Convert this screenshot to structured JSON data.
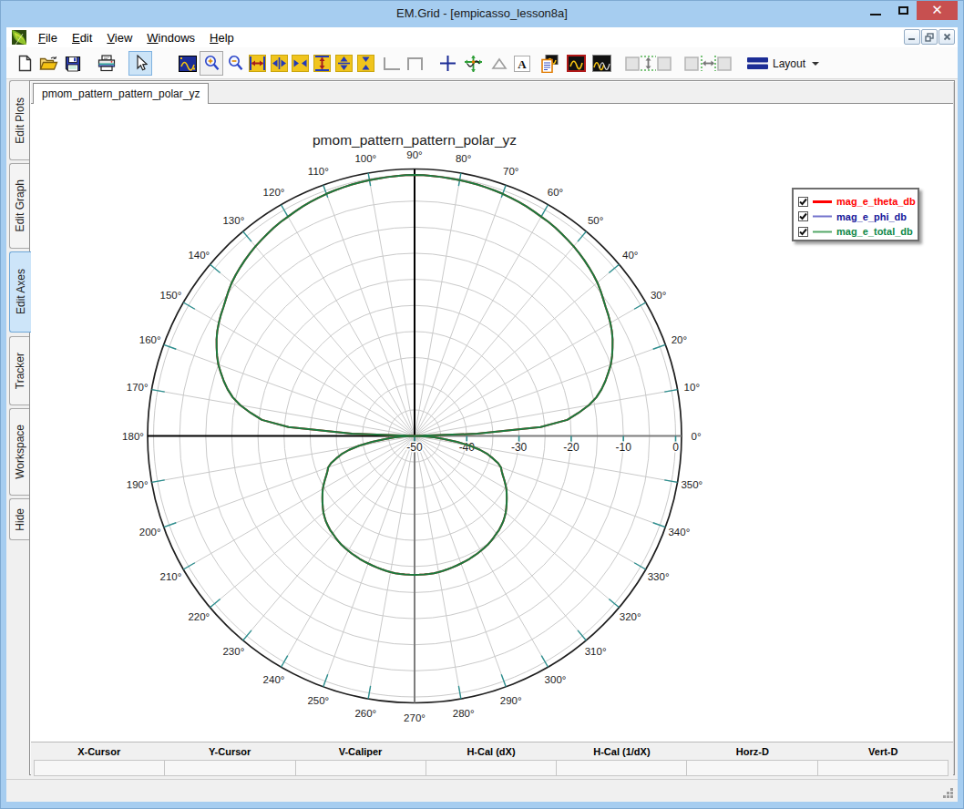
{
  "window": {
    "title": "EM.Grid - [empicasso_lesson8a]",
    "controls": [
      "minimize",
      "maximize",
      "close"
    ]
  },
  "menu": {
    "items": [
      {
        "label": "File",
        "underline_index": 0
      },
      {
        "label": "Edit",
        "underline_index": 0
      },
      {
        "label": "View",
        "underline_index": 0
      },
      {
        "label": "Windows",
        "underline_index": 0
      },
      {
        "label": "Help",
        "underline_index": 0
      }
    ],
    "mdi_controls": [
      "minimize",
      "restore",
      "close"
    ]
  },
  "toolbar": {
    "buttons": [
      {
        "name": "new-document",
        "state": "normal"
      },
      {
        "name": "open-folder",
        "state": "normal"
      },
      {
        "name": "save-floppy",
        "state": "normal"
      },
      {
        "name": "print",
        "state": "normal"
      },
      {
        "name": "select-cursor",
        "state": "active"
      },
      {
        "name": "fit-plot",
        "state": "normal"
      },
      {
        "name": "zoom-in",
        "state": "framed"
      },
      {
        "name": "zoom-out",
        "state": "normal"
      },
      {
        "name": "expand-x-full",
        "state": "normal"
      },
      {
        "name": "expand-x",
        "state": "normal"
      },
      {
        "name": "compress-x",
        "state": "normal"
      },
      {
        "name": "expand-y-full",
        "state": "normal"
      },
      {
        "name": "expand-y",
        "state": "normal"
      },
      {
        "name": "compress-y",
        "state": "normal"
      },
      {
        "name": "corner-bottom-left",
        "state": "disabled"
      },
      {
        "name": "corner-top",
        "state": "disabled"
      },
      {
        "name": "crosshair-plus",
        "state": "normal"
      },
      {
        "name": "tracker-axes",
        "state": "normal"
      },
      {
        "name": "triangle-marker",
        "state": "disabled"
      },
      {
        "name": "text-annotation",
        "state": "normal"
      },
      {
        "name": "copy-plot-report",
        "state": "normal"
      },
      {
        "name": "plot-window-active",
        "state": "normal"
      },
      {
        "name": "plot-window-all",
        "state": "normal"
      },
      {
        "name": "tile-box-left",
        "state": "disabled"
      },
      {
        "name": "space-vertical",
        "state": "disabled"
      },
      {
        "name": "tile-box-right",
        "state": "disabled"
      },
      {
        "name": "tile-box-left2",
        "state": "disabled"
      },
      {
        "name": "space-horizontal",
        "state": "disabled"
      },
      {
        "name": "tile-box-right2",
        "state": "disabled"
      }
    ],
    "layout_label": "Layout"
  },
  "sidebar": {
    "tabs": [
      {
        "label": "Edit Plots",
        "selected": false
      },
      {
        "label": "Edit Graph",
        "selected": false
      },
      {
        "label": "Edit Axes",
        "selected": true
      },
      {
        "label": "Tracker",
        "selected": false
      },
      {
        "label": "Workspace",
        "selected": false
      },
      {
        "label": "Hide",
        "selected": false
      }
    ]
  },
  "document_tabs": [
    {
      "label": "pmom_pattern_pattern_polar_yz",
      "active": true
    }
  ],
  "chart_data": {
    "type": "polar-line",
    "title": "pmom_pattern_pattern_polar_yz",
    "angle_unit": "deg",
    "angle_labels": [
      "0°",
      "10°",
      "20°",
      "30°",
      "40°",
      "50°",
      "60°",
      "70°",
      "80°",
      "90°",
      "100°",
      "110°",
      "120°",
      "130°",
      "140°",
      "150°",
      "160°",
      "170°",
      "180°",
      "190°",
      "200°",
      "210°",
      "220°",
      "230°",
      "240°",
      "250°",
      "260°",
      "270°",
      "280°",
      "290°",
      "300°",
      "310°",
      "320°",
      "330°",
      "340°",
      "350°"
    ],
    "angle_grid_step_deg": 10,
    "radial_axis": {
      "min": -50,
      "max": 0,
      "label_step": 10,
      "grid_step": 5,
      "tick_labels": [
        "-50",
        "-40",
        "-30",
        "-20",
        "-10",
        "0"
      ]
    },
    "grid": true,
    "legend": {
      "position": "top-right",
      "entries": [
        {
          "label": "mag_e_theta_db",
          "checked": true,
          "text_color": "#ff0000",
          "line_color": "#ff0000",
          "line_width": 3
        },
        {
          "label": "mag_e_phi_db",
          "checked": true,
          "text_color": "#16169a",
          "line_color": "#7373cc",
          "line_width": 2
        },
        {
          "label": "mag_e_total_db",
          "checked": true,
          "text_color": "#0d8747",
          "line_color": "#54a868",
          "line_width": 2
        }
      ]
    },
    "series": [
      {
        "name": "mag_e_theta_db",
        "color": "#d22a2a",
        "note": "coincides with mag_e_total_db curve (hidden beneath it)",
        "coincident_with": "mag_e_total_db"
      },
      {
        "name": "mag_e_phi_db",
        "color": "#7373cc",
        "note": "below -50 dB over the whole cut; collapses to plot centre, not visible",
        "values_db": null
      },
      {
        "name": "mag_e_total_db",
        "color": "#1b7a3e",
        "angles_deg": [
          0,
          2,
          4,
          6,
          8,
          10,
          12,
          14,
          16,
          18,
          20,
          22,
          24,
          26,
          28,
          30,
          32,
          34,
          36,
          38,
          40,
          42,
          44,
          46,
          48,
          50,
          52,
          54,
          56,
          58,
          60,
          62,
          64,
          66,
          68,
          70,
          72,
          74,
          76,
          78,
          80,
          82,
          84,
          86,
          88,
          90,
          92,
          94,
          96,
          98,
          100,
          102,
          104,
          106,
          108,
          110,
          112,
          114,
          116,
          118,
          120,
          122,
          124,
          126,
          128,
          130,
          132,
          134,
          136,
          138,
          140,
          142,
          144,
          146,
          148,
          150,
          152,
          154,
          156,
          158,
          160,
          162,
          164,
          166,
          168,
          170,
          172,
          174,
          176,
          178,
          180,
          182,
          184,
          186,
          188,
          190,
          192,
          194,
          196,
          198,
          200,
          202,
          204,
          206,
          208,
          210,
          212,
          214,
          216,
          218,
          220,
          222,
          224,
          226,
          228,
          230,
          232,
          234,
          236,
          238,
          240,
          242,
          244,
          246,
          248,
          250,
          252,
          254,
          256,
          258,
          260,
          262,
          264,
          266,
          268,
          270,
          272,
          274,
          276,
          278,
          280,
          282,
          284,
          286,
          288,
          290,
          292,
          294,
          296,
          298,
          300,
          302,
          304,
          306,
          308,
          310,
          312,
          314,
          316,
          318,
          320,
          322,
          324,
          326,
          328,
          330,
          332,
          334,
          336,
          338,
          340,
          342,
          344,
          346,
          348,
          350,
          352,
          354,
          356,
          358,
          360
        ],
        "values_db": [
          -50,
          -38,
          -25.8,
          -20.6,
          -18.3,
          -16.1,
          -14.4,
          -13.1,
          -12.0,
          -11.0,
          -10.0,
          -9.2,
          -8.5,
          -7.8,
          -7.2,
          -6.7,
          -6.25,
          -5.85,
          -5.35,
          -4.8,
          -4.3,
          -3.9,
          -3.55,
          -3.2,
          -2.9,
          -2.6,
          -2.35,
          -2.1,
          -1.85,
          -1.65,
          -1.5,
          -1.3,
          -1.1,
          -0.95,
          -0.8,
          -0.65,
          -0.55,
          -0.45,
          -0.36,
          -0.3,
          -0.26,
          -0.2,
          -0.14,
          -0.08,
          -0.03,
          0,
          -0.03,
          -0.08,
          -0.14,
          -0.2,
          -0.26,
          -0.3,
          -0.36,
          -0.45,
          -0.55,
          -0.65,
          -0.8,
          -0.95,
          -1.1,
          -1.3,
          -1.5,
          -1.65,
          -1.85,
          -2.1,
          -2.35,
          -2.6,
          -2.9,
          -3.2,
          -3.55,
          -3.9,
          -4.3,
          -4.8,
          -5.35,
          -5.85,
          -6.25,
          -6.7,
          -7.2,
          -7.8,
          -8.5,
          -9.2,
          -10.0,
          -11.0,
          -12.0,
          -13.1,
          -14.4,
          -16.1,
          -18.3,
          -20.6,
          -25.8,
          -38,
          -50,
          -48,
          -46.2,
          -44.5,
          -41.8,
          -39.2,
          -37.2,
          -35.6,
          -34.4,
          -33.2,
          -32.4,
          -32.0,
          -31.5,
          -30.9,
          -30.3,
          -29.7,
          -29.2,
          -28.7,
          -28.2,
          -27.7,
          -27.2,
          -26.8,
          -26.4,
          -26.1,
          -25.8,
          -25.6,
          -25.35,
          -25.1,
          -24.9,
          -24.75,
          -24.6,
          -24.45,
          -24.35,
          -24.2,
          -24.1,
          -24.0,
          -23.9,
          -23.8,
          -23.7,
          -23.6,
          -23.5,
          -23.45,
          -23.42,
          -23.4,
          -23.4,
          -23.4,
          -23.4,
          -23.4,
          -23.42,
          -23.45,
          -23.5,
          -23.6,
          -23.7,
          -23.8,
          -23.9,
          -24.0,
          -24.1,
          -24.2,
          -24.35,
          -24.45,
          -24.6,
          -24.75,
          -24.9,
          -25.1,
          -25.35,
          -25.6,
          -25.8,
          -26.1,
          -26.4,
          -26.8,
          -27.2,
          -27.7,
          -28.2,
          -28.7,
          -29.2,
          -29.7,
          -30.3,
          -30.9,
          -31.5,
          -32.0,
          -32.4,
          -33.2,
          -34.4,
          -35.6,
          -37.2,
          -39.2,
          -41.8,
          -44.5,
          -46.2,
          -48,
          -50
        ]
      }
    ],
    "style": {
      "outer_ring_color": "#1f1f1f",
      "grid_color": "#cacaca",
      "axis_dark_color": "#000000",
      "axis_gray_color": "#7d7d7d",
      "tick_color": "#2d8f8f",
      "label_color": "#1c1c1c",
      "background": "#ffffff"
    }
  },
  "tracker": {
    "columns": [
      "X-Cursor",
      "Y-Cursor",
      "V-Caliper",
      "H-Cal (dX)",
      "H-Cal (1/dX)",
      "Horz-D",
      "Vert-D"
    ],
    "values": [
      "",
      "",
      "",
      "",
      "",
      "",
      ""
    ]
  },
  "statusbar": {
    "text": ""
  }
}
